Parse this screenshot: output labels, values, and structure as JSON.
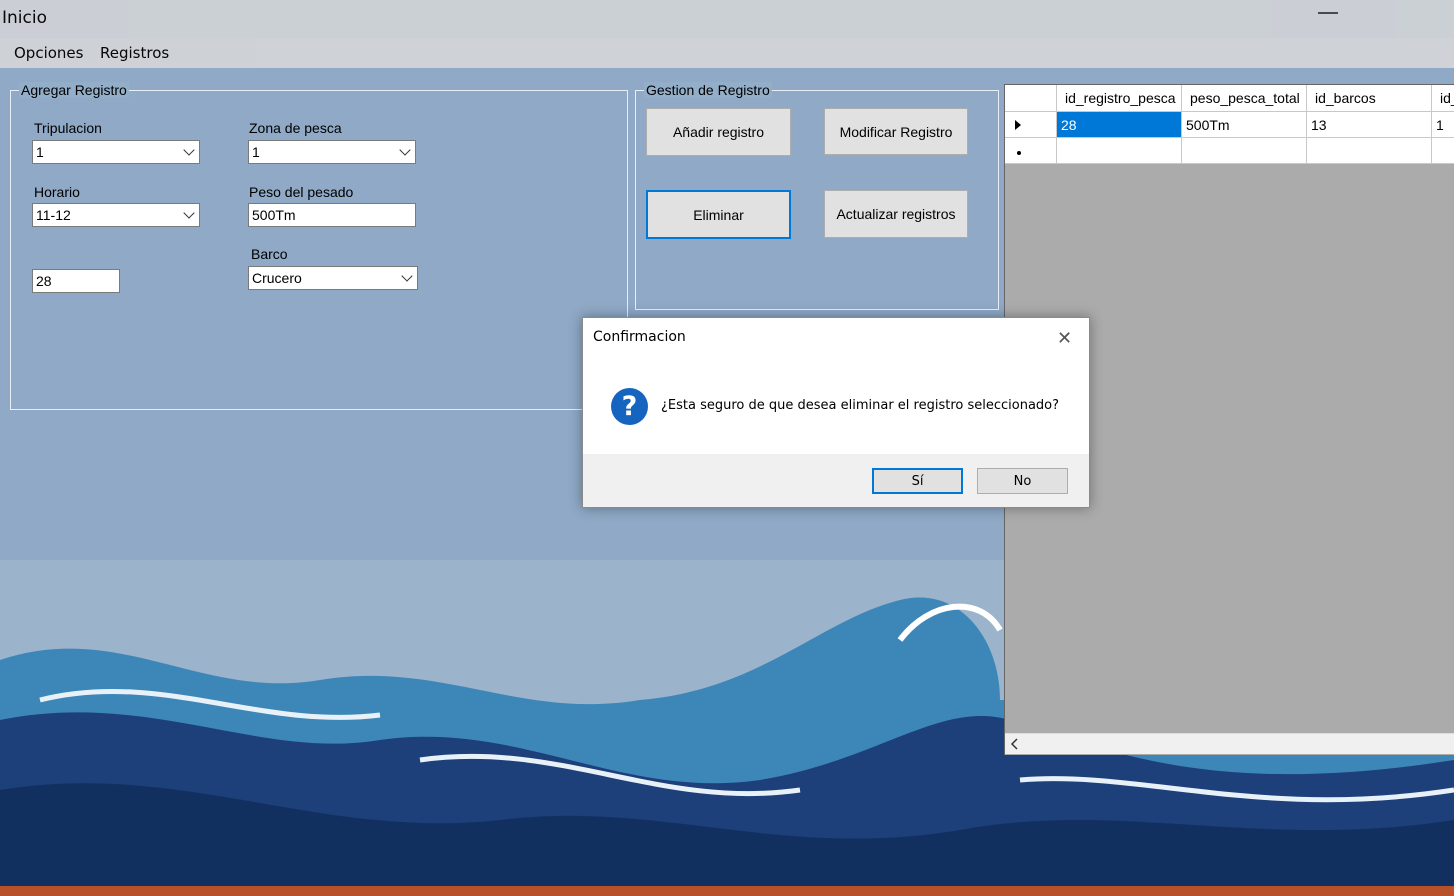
{
  "window": {
    "title": "Inicio"
  },
  "menu": {
    "items": [
      "Opciones",
      "Registros"
    ]
  },
  "agregar": {
    "legend": "Agregar Registro",
    "tripulacion_label": "Tripulacion",
    "tripulacion_value": "1",
    "zona_label": "Zona de pesca",
    "zona_value": "1",
    "horario_label": "Horario",
    "horario_value": "11-12",
    "peso_label": "Peso del pesado",
    "peso_value": "500Tm",
    "barco_label": "Barco",
    "barco_value": "Crucero",
    "id_value": "28"
  },
  "gestion": {
    "legend": "Gestion de Registro",
    "add_label": "Añadir registro",
    "modify_label": "Modificar Registro",
    "delete_label": "Eliminar",
    "update_label": "Actualizar registros"
  },
  "grid": {
    "columns": [
      "id_registro_pesca",
      "peso_pesca_total",
      "id_barcos",
      "id_"
    ],
    "rows": [
      [
        "28",
        "500Tm",
        "13",
        "1"
      ]
    ]
  },
  "dialog": {
    "title": "Confirmacion",
    "message": "¿Esta seguro de que desea eliminar el registro seleccionado?",
    "yes_label": "Sí",
    "no_label": "No",
    "icon": "question-icon",
    "icon_glyph": "?"
  },
  "colors": {
    "accent": "#0078d7",
    "background": "#8fa9c6",
    "wave_dark": "#1d3f7a",
    "wave_mid": "#3d87b8"
  }
}
